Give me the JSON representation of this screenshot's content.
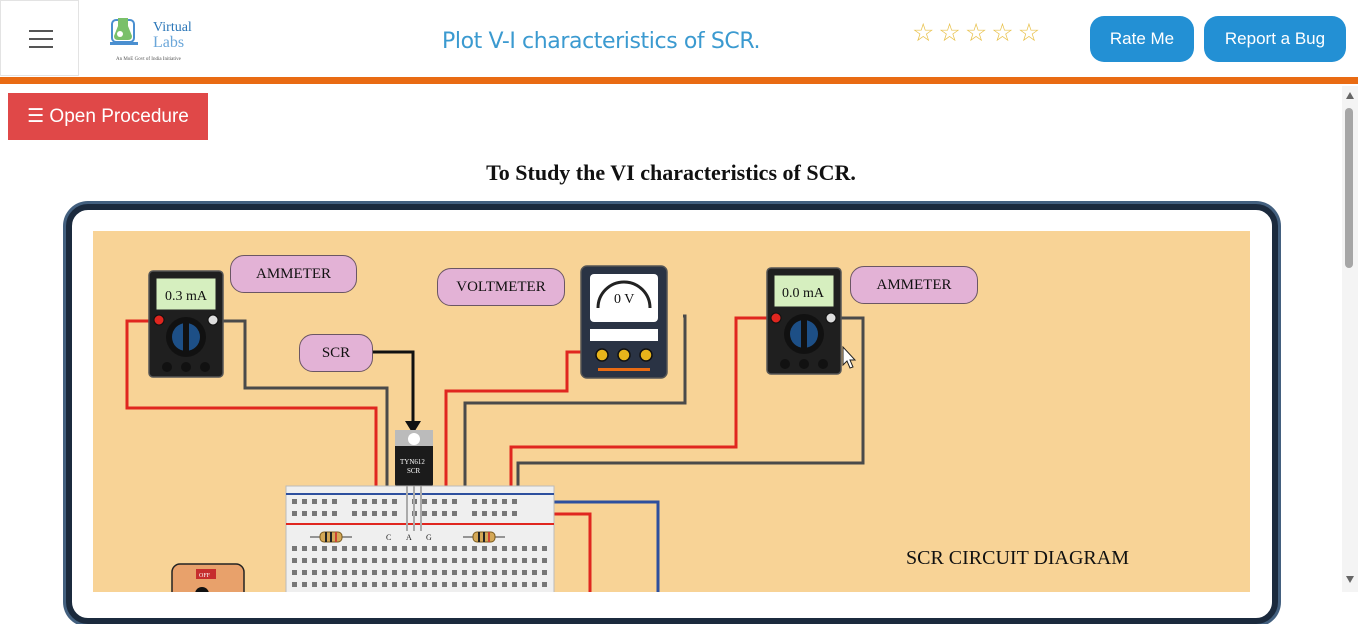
{
  "header": {
    "logo_text_top": "Virtual",
    "logo_text_bottom": "Labs",
    "logo_tagline": "An MoE Govt of India Initiative",
    "title": "Plot V-I characteristics of SCR.",
    "rating_stars": 5,
    "rate_button": "Rate Me",
    "bug_button": "Report a Bug"
  },
  "procedure_button": "☰ Open Procedure",
  "simulation": {
    "title": "To Study the VI characteristics of SCR.",
    "labels": {
      "ammeter_left": "AMMETER",
      "ammeter_right": "AMMETER",
      "voltmeter": "VOLTMETER",
      "scr": "SCR",
      "diagram": "SCR CIRCUIT DIAGRAM"
    },
    "readings": {
      "ammeter_left": "0.3 mA",
      "ammeter_right": "0.0 mA",
      "voltmeter": "0 V"
    },
    "scr_device_line1": "TYN612",
    "scr_device_line2": "SCR",
    "breadboard_pins": [
      "C",
      "A",
      "G"
    ],
    "switch_label": "OFF"
  },
  "colors": {
    "accent_orange": "#e96b13",
    "title_blue": "#3b9ad0",
    "button_blue": "#2390d4",
    "procedure_red": "#e04848",
    "canvas_bg": "#f8d396",
    "label_bg": "#e3b2d6",
    "wire_red": "#e0261f",
    "wire_gray": "#4a4a4a",
    "wire_blue": "#2d4f9e"
  },
  "icons": {
    "menu": "hamburger-icon",
    "star": "star-outline-icon",
    "cursor": "mouse-pointer-icon"
  }
}
